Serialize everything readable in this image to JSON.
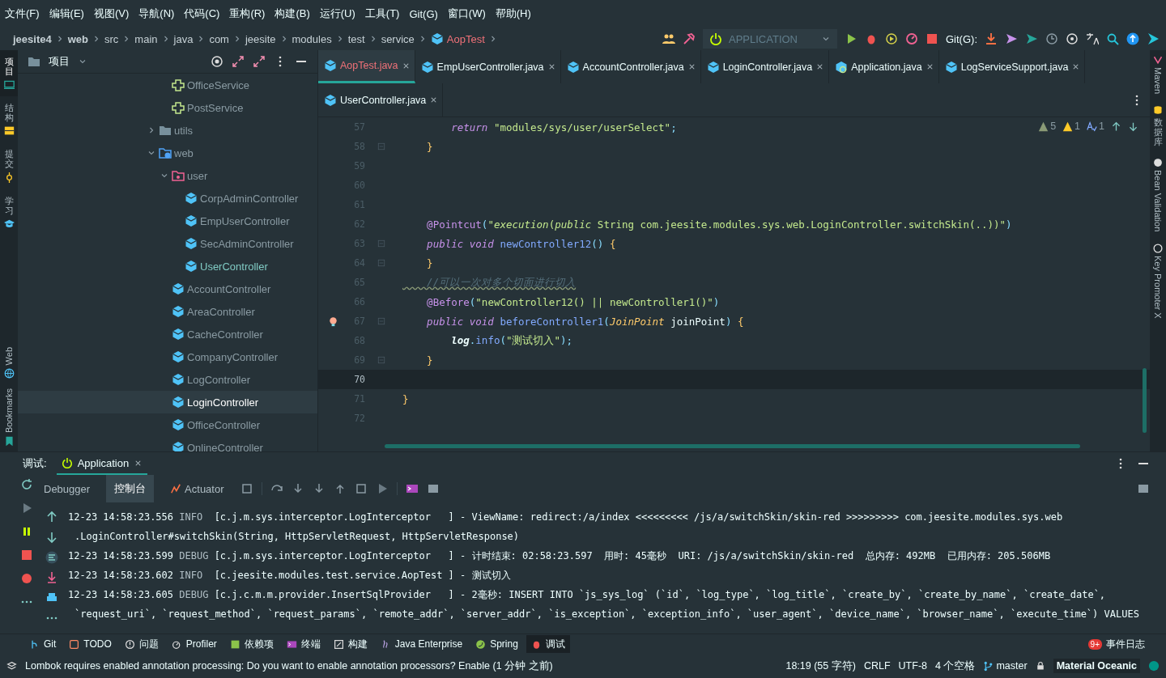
{
  "menu": [
    "文件(F)",
    "编辑(E)",
    "视图(V)",
    "导航(N)",
    "代码(C)",
    "重构(R)",
    "构建(B)",
    "运行(U)",
    "工具(T)",
    "Git(G)",
    "窗口(W)",
    "帮助(H)"
  ],
  "breadcrumb": [
    {
      "label": "jeesite4",
      "bold": true
    },
    {
      "label": "web",
      "bold": true
    },
    {
      "label": "src",
      "bold": false
    },
    {
      "label": "main",
      "bold": false
    },
    {
      "label": "java",
      "bold": false
    },
    {
      "label": "com",
      "bold": false
    },
    {
      "label": "jeesite",
      "bold": false
    },
    {
      "label": "modules",
      "bold": false
    },
    {
      "label": "test",
      "bold": false
    },
    {
      "label": "service",
      "bold": false
    },
    {
      "label": "AopTest",
      "bold": false,
      "kind": "class"
    }
  ],
  "toolbar": {
    "run_config": "APPLICATION",
    "git_label": "Git(G):"
  },
  "left_strip": {
    "top": [
      {
        "label": "项目",
        "selected": true
      },
      {
        "label": "结构",
        "selected": false
      },
      {
        "label": "提交",
        "selected": false
      },
      {
        "label": "学习",
        "selected": false
      }
    ],
    "bottom": [
      "Web",
      "Bookmarks"
    ]
  },
  "right_strip": [
    "Maven",
    "数据库",
    "Bean Validation",
    "Key Promoter X"
  ],
  "project": {
    "title": "项目",
    "orphans": [
      {
        "label": "OfficeService",
        "kind": "interface",
        "selected": false,
        "modified": false
      },
      {
        "label": "PostService",
        "kind": "interface",
        "selected": false,
        "modified": false
      }
    ],
    "tree": [
      {
        "label": "utils",
        "kind": "folder",
        "expanded": false,
        "selected": false,
        "modified": false
      },
      {
        "label": "web",
        "kind": "web-folder",
        "expanded": true,
        "selected": false,
        "modified": false,
        "children": [
          {
            "label": "user",
            "kind": "user-folder",
            "expanded": true,
            "selected": false,
            "modified": false,
            "children": [
              {
                "label": "CorpAdminController",
                "kind": "class",
                "selected": false,
                "modified": false
              },
              {
                "label": "EmpUserController",
                "kind": "class",
                "selected": false,
                "modified": false
              },
              {
                "label": "SecAdminController",
                "kind": "class",
                "selected": false,
                "modified": false
              },
              {
                "label": "UserController",
                "kind": "class",
                "selected": false,
                "modified": true
              }
            ]
          },
          {
            "label": "AccountController",
            "kind": "class",
            "selected": false,
            "modified": false
          },
          {
            "label": "AreaController",
            "kind": "class",
            "selected": false,
            "modified": false
          },
          {
            "label": "CacheController",
            "kind": "class",
            "selected": false,
            "modified": false
          },
          {
            "label": "CompanyController",
            "kind": "class",
            "selected": false,
            "modified": false
          },
          {
            "label": "LogController",
            "kind": "class",
            "selected": false,
            "modified": false
          },
          {
            "label": "LoginController",
            "kind": "class",
            "selected": true,
            "modified": false
          },
          {
            "label": "OfficeController",
            "kind": "class",
            "selected": false,
            "modified": false
          },
          {
            "label": "OnlineController",
            "kind": "class",
            "selected": false,
            "modified": false
          }
        ]
      }
    ]
  },
  "editor": {
    "tabs": [
      {
        "label": "AopTest.java",
        "kind": "class",
        "selected": true
      },
      {
        "label": "EmpUserController.java",
        "kind": "class",
        "selected": false
      },
      {
        "label": "AccountController.java",
        "kind": "class",
        "selected": false
      },
      {
        "label": "LoginController.java",
        "kind": "class",
        "selected": false
      },
      {
        "label": "Application.java",
        "kind": "app",
        "selected": false
      },
      {
        "label": "LogServiceSupport.java",
        "kind": "class",
        "selected": false
      },
      {
        "label": "UserController.java",
        "kind": "class",
        "selected": false
      }
    ],
    "inspections": [
      {
        "kind": "weak",
        "count": "5"
      },
      {
        "kind": "warning",
        "count": "1"
      },
      {
        "kind": "typo",
        "count": "1"
      }
    ],
    "lines": [
      {
        "number": "57",
        "fold": false,
        "bulb": false,
        "current": false,
        "tokens": [
          {
            "kind": "kw",
            "text": "        return "
          },
          {
            "kind": "str",
            "text": "\"modules/sys/user/userSelect\""
          },
          {
            "kind": "punct",
            "text": ";"
          }
        ]
      },
      {
        "number": "58",
        "fold": true,
        "bulb": false,
        "current": false,
        "tokens": [
          {
            "kind": "brace",
            "text": "    }"
          }
        ]
      },
      {
        "number": "59",
        "fold": false,
        "bulb": false,
        "current": false
      },
      {
        "number": "60",
        "fold": false,
        "bulb": false,
        "current": false
      },
      {
        "number": "61",
        "fold": false,
        "bulb": false,
        "current": false
      },
      {
        "number": "62",
        "fold": false,
        "bulb": false,
        "current": false,
        "tokens": [
          {
            "kind": "ann",
            "text": "    @Pointcut"
          },
          {
            "kind": "punct",
            "text": "("
          },
          {
            "kind": "str",
            "text": "\""
          },
          {
            "kind": "stri",
            "text": "execution"
          },
          {
            "kind": "str",
            "text": "("
          },
          {
            "kind": "stri",
            "text": "public"
          },
          {
            "kind": "str",
            "text": " String com.jeesite.modules.sys.web.LoginController.switchSkin(..))\""
          },
          {
            "kind": "punct",
            "text": ")"
          }
        ]
      },
      {
        "number": "63",
        "fold": true,
        "bulb": false,
        "current": false,
        "tokens": [
          {
            "kind": "kw",
            "text": "    public void "
          },
          {
            "kind": "fn",
            "text": "newController12"
          },
          {
            "kind": "punct",
            "text": "() "
          },
          {
            "kind": "brace",
            "text": "{"
          }
        ]
      },
      {
        "number": "64",
        "fold": true,
        "bulb": false,
        "current": false,
        "tokens": [
          {
            "kind": "brace",
            "text": "    }"
          }
        ]
      },
      {
        "number": "65",
        "fold": false,
        "bulb": false,
        "current": false,
        "tokens": [
          {
            "kind": "comment",
            "text": "    //可以一次对多个切面进行切入"
          }
        ]
      },
      {
        "number": "66",
        "fold": false,
        "bulb": false,
        "current": false,
        "tokens": [
          {
            "kind": "ann",
            "text": "    @Before"
          },
          {
            "kind": "punct",
            "text": "("
          },
          {
            "kind": "str",
            "text": "\"newController12() || newController1()\""
          },
          {
            "kind": "punct",
            "text": ")"
          }
        ]
      },
      {
        "number": "67",
        "fold": true,
        "bulb": true,
        "current": false,
        "tokens": [
          {
            "kind": "kw",
            "text": "    public void "
          },
          {
            "kind": "fn",
            "text": "beforeController1"
          },
          {
            "kind": "punct",
            "text": "("
          },
          {
            "kind": "type",
            "text": "JoinPoint"
          },
          {
            "kind": "plain",
            "text": " joinPoint"
          },
          {
            "kind": "punct",
            "text": ") "
          },
          {
            "kind": "brace",
            "text": "{"
          }
        ]
      },
      {
        "number": "68",
        "fold": false,
        "bulb": false,
        "current": false,
        "tokens": [
          {
            "kind": "field",
            "text": "        log"
          },
          {
            "kind": "punct",
            "text": "."
          },
          {
            "kind": "fn",
            "text": "info"
          },
          {
            "kind": "punct",
            "text": "("
          },
          {
            "kind": "str",
            "text": "\"测试切入\""
          },
          {
            "kind": "punct",
            "text": ");"
          }
        ]
      },
      {
        "number": "69",
        "fold": true,
        "bulb": false,
        "current": false,
        "tokens": [
          {
            "kind": "brace",
            "text": "    }"
          }
        ]
      },
      {
        "number": "70",
        "fold": false,
        "bulb": false,
        "current": true
      },
      {
        "number": "71",
        "fold": false,
        "bulb": false,
        "current": false,
        "tokens": [
          {
            "kind": "brace",
            "text": "}"
          }
        ]
      },
      {
        "number": "72",
        "fold": false,
        "bulb": false,
        "current": false
      }
    ]
  },
  "debug": {
    "label": "调试:",
    "session": "Application",
    "tabs": [
      {
        "label": "Debugger",
        "selected": false
      },
      {
        "label": "控制台",
        "selected": true
      },
      {
        "label": "Actuator",
        "selected": false
      }
    ],
    "console": [
      {
        "kind": "entry",
        "time": "12-23 14:58:23.556",
        "level": "INFO",
        "logger": "[c.j.m.sys.interceptor.LogInterceptor   ]",
        "message": "- ViewName: redirect:/a/index <<<<<<<<< /js/a/switchSkin/skin-red >>>>>>>>> com.jeesite.modules.sys.web"
      },
      {
        "kind": "continuation",
        "message": ".LoginController#switchSkin(String, HttpServletRequest, HttpServletResponse)"
      },
      {
        "kind": "entry",
        "time": "12-23 14:58:23.599",
        "level": "DEBUG",
        "logger": "[c.j.m.sys.interceptor.LogInterceptor   ]",
        "message": "- 计时结束: 02:58:23.597  用时: 45毫秒  URI: /js/a/switchSkin/skin-red  总内存: 492MB  已用内存: 205.506MB"
      },
      {
        "kind": "entry",
        "time": "12-23 14:58:23.602",
        "level": "INFO",
        "logger": "[c.jeesite.modules.test.service.AopTest ]",
        "message": "- 测试切入"
      },
      {
        "kind": "entry",
        "time": "12-23 14:58:23.605",
        "level": "DEBUG",
        "logger": "[c.j.c.m.m.provider.InsertSqlProvider   ]",
        "message": "- 2毫秒: INSERT INTO `js_sys_log` (`id`, `log_type`, `log_title`, `create_by`, `create_by_name`, `create_date`,"
      },
      {
        "kind": "continuation",
        "message": "`request_uri`, `request_method`, `request_params`, `remote_addr`, `server_addr`, `is_exception`, `exception_info`, `user_agent`, `device_name`, `browser_name`, `execute_time`) VALUES"
      }
    ]
  },
  "tool_windows": [
    {
      "label": "Git",
      "kind": "git",
      "selected": false
    },
    {
      "label": "TODO",
      "kind": "todo",
      "selected": false
    },
    {
      "label": "问题",
      "kind": "problems",
      "selected": false
    },
    {
      "label": "Profiler",
      "kind": "profiler",
      "selected": false
    },
    {
      "label": "依赖项",
      "kind": "deps",
      "selected": false
    },
    {
      "label": "终端",
      "kind": "terminal",
      "selected": false
    },
    {
      "label": "构建",
      "kind": "build",
      "selected": false
    },
    {
      "label": "Java Enterprise",
      "kind": "javaee",
      "selected": false
    },
    {
      "label": "Spring",
      "kind": "spring",
      "selected": false
    },
    {
      "label": "调试",
      "kind": "debug",
      "selected": true
    }
  ],
  "event_log": {
    "badge": "9+",
    "label": "事件日志"
  },
  "status_bar": {
    "message": "Lombok requires enabled annotation processing: Do you want to enable annotation processors? Enable (1 分钟 之前)",
    "position": "18:19 (55 字符)",
    "line_ending": "CRLF",
    "encoding": "UTF-8",
    "indent": "4 个空格",
    "branch": "master",
    "theme": "Material Oceanic"
  }
}
